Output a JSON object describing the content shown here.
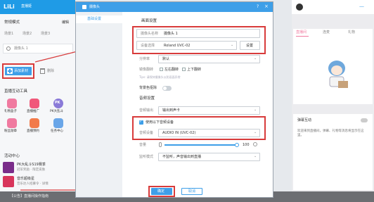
{
  "app": {
    "brand": "LiLi",
    "title": "直播姬",
    "mode": "常规模式",
    "manage": "编辑",
    "scene_tabs": [
      "场景1",
      "场景2",
      "场景3"
    ],
    "source_name": "摄像头 1",
    "add_source_label": "添加素材",
    "delete_label": "删除",
    "tools_title": "直播互动工具",
    "tools": [
      {
        "label": "礼物盒子",
        "color": "#f07aa0"
      },
      {
        "label": "直播推广",
        "color": "#f0587a"
      },
      {
        "label": "PK大乱斗",
        "color": "#8a7ad8",
        "glyph": "PK"
      },
      {
        "label": "粉丝勋章",
        "color": "#f07aa0"
      },
      {
        "label": "直播预约",
        "color": "#f27a4a"
      },
      {
        "label": "任务中心",
        "color": "#6aa6e8"
      }
    ],
    "activity_title": "活动中心",
    "activities": [
      {
        "title": "PK大乱斗S19赛季",
        "sub": "冠军奖励 · 限定皮肤",
        "color": "#7a2d8a"
      },
      {
        "title": "音乐超级星",
        "sub": "音乐达人招募令 · 详情",
        "color": "#d8365c"
      }
    ],
    "bottom_text": "【公告】直播间操作指南"
  },
  "dialog": {
    "title": "摄像头",
    "help_icon": "?",
    "close_icon": "×",
    "sidebar_tab": "基础设置",
    "video_section": "画面设置",
    "name_label": "摄像头名称",
    "name_value": "摄像头 1",
    "device_label": "设备选择",
    "device_value": "Roland UVC-02",
    "settings_button": "设置",
    "resolution_label": "分辨率",
    "resolution_value": "默认",
    "flip_label": "镜像翻转",
    "flip_h": "左右翻转",
    "flip_v": "上下翻转",
    "tip": "Tips: 请保持摄像头以防画面异常",
    "beauty_label": "背景色抠除",
    "audio_section": "音频设置",
    "audio_output_label": "音频输出",
    "audio_output_value": "输出到声卡",
    "use_independent_audio": "使用以下音频设备",
    "audio_device_label": "音频设备",
    "audio_device_value": "AUDIO IN (UVC-02)",
    "volume_label": "音量",
    "volume_value": "100",
    "volume_pct": 0.98,
    "mode_label": "监听模式",
    "mode_value": "不监听，声音输出到直播",
    "confirm_button": "确定",
    "cancel_button": "取消"
  },
  "right": {
    "title_tab": "直播间",
    "tab2": "连麦",
    "tab3": "礼物",
    "danmu_title": "弹幕互动",
    "danmu_text": "欢迎来到直播间，弹幕、礼物等消息将显示在这里。"
  }
}
